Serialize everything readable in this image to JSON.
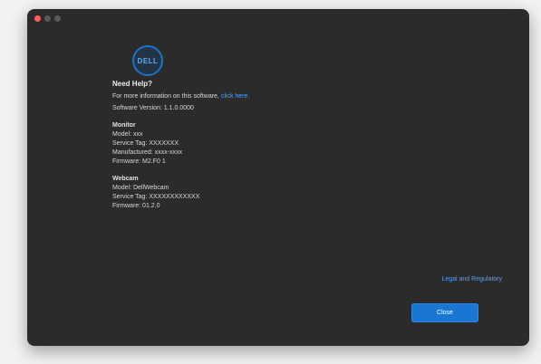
{
  "colors": {
    "window_bg": "#2b2b2b",
    "accent": "#1976d2",
    "link": "#4da3ff",
    "traffic_close": "#ff5f57",
    "traffic_min": "#5a5a5a",
    "traffic_max": "#5a5a5a"
  },
  "logo": {
    "text": "DELL"
  },
  "about": {
    "heading": "Need Help?",
    "help_text": "For more information on this software,",
    "help_link": "click here.",
    "software_version": "Software Version: 1.1.0.0000"
  },
  "monitor": {
    "title": "Monitor",
    "lines": [
      "Model: xxx",
      "Service Tag: XXXXXXX",
      "Manufactured: xxxx-xxxx",
      "Firmware: M2.F0 1"
    ]
  },
  "webcam": {
    "title": "Webcam",
    "lines": [
      "Model: DellWebcam",
      "Service Tag: XXXXXXXXXXXX",
      "Firmware: 01.2.0"
    ]
  },
  "footer": {
    "link": "Legal and Regulatory",
    "button_label": "Close"
  }
}
